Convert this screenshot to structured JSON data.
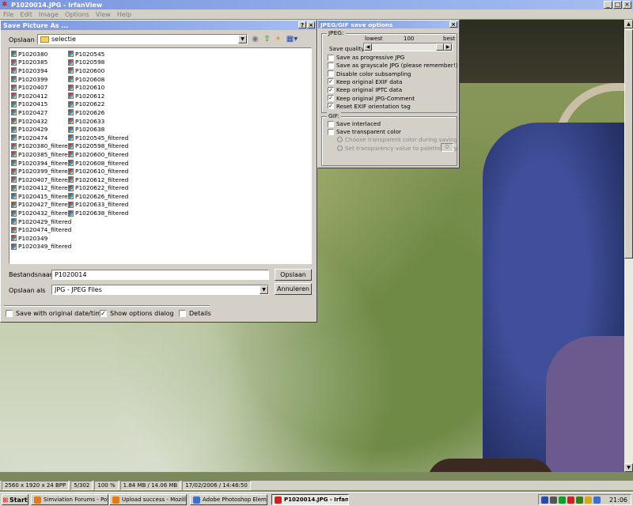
{
  "window": {
    "title": "P1020014.JPG - IrfanView",
    "menu": [
      "File",
      "Edit",
      "Image",
      "Options",
      "View",
      "Help"
    ]
  },
  "dialog": {
    "title": "Save Picture As ...",
    "look_in_label": "Opslaan in:",
    "look_in_value": "selectie",
    "files_col1": [
      "P1020380",
      "P1020385",
      "P1020394",
      "P1020399",
      "P1020407",
      "P1020412",
      "P1020415",
      "P1020427",
      "P1020432",
      "P1020429",
      "P1020474",
      "P1020380_filtered",
      "P1020385_filtered",
      "P1020394_filtered",
      "P1020399_filtered",
      "P1020407_filtered",
      "P1020412_filtered",
      "P1020415_filtered",
      "P1020427_filtered",
      "P1020432_filtered",
      "P1020429_filtered",
      "P1020474_filtered",
      "P1020349",
      "P1020349_filtered"
    ],
    "files_col2": [
      "P1020545",
      "P1020598",
      "P1020600",
      "P1020608",
      "P1020610",
      "P1020612",
      "P1020622",
      "P1020626",
      "P1020633",
      "P1020638",
      "P1020545_filtered",
      "P1020598_filtered",
      "P1020600_filtered",
      "P1020608_filtered",
      "P1020610_filtered",
      "P1020612_filtered",
      "P1020622_filtered",
      "P1020626_filtered",
      "P1020633_filtered",
      "P1020638_filtered"
    ],
    "filename_label": "Bestandsnaam:",
    "filename_value": "P1020014",
    "save_button": "Opslaan",
    "savetype_label": "Opslaan als",
    "savetype_value": "JPG - JPEG Files",
    "cancel_button": "Annuleren",
    "opt_original_date": "Save with original date/time",
    "opt_original_date_checked": false,
    "opt_show_options": "Show options dialog",
    "opt_show_options_checked": true,
    "opt_details": "Details",
    "opt_details_checked": false
  },
  "options": {
    "title": "JPEG/GIF save options",
    "jpeg_group": "JPEG:",
    "quality_label": "Save quality:",
    "quality_min_label": "lowest",
    "quality_value": "100",
    "quality_max_label": "best",
    "quality_fraction": 1.0,
    "jpeg_checks": [
      {
        "label": "Save as progressive JPG",
        "checked": false
      },
      {
        "label": "Save as grayscale JPG (please remember!)",
        "checked": false
      },
      {
        "label": "Disable color subsampling",
        "checked": false
      },
      {
        "label": "Keep original EXIF data",
        "checked": true
      },
      {
        "label": "Keep original IPTC data",
        "checked": true
      },
      {
        "label": "Keep original JPG-Comment",
        "checked": true
      },
      {
        "label": "Reset EXIF orientation tag",
        "checked": true
      }
    ],
    "gif_group": "GIF:",
    "gif_checks": [
      {
        "label": "Save interlaced",
        "checked": false
      },
      {
        "label": "Save transparent color",
        "checked": false
      }
    ],
    "gif_radio1": "Choose transparent color during saving",
    "gif_radio2": "Set transparency value to palette entry:",
    "palette_entry": "0"
  },
  "status": {
    "dimensions": "2560 x 1920 x 24 BPP",
    "index": "5/302",
    "zoom": "100 %",
    "size": "1.84 MB / 14.06 MB",
    "datetime": "17/02/2006 / 14:46:50"
  },
  "taskbar": {
    "start": "Start",
    "tasks": [
      {
        "label": "Simviation Forums - Post ...",
        "color": "#e07b1a"
      },
      {
        "label": "Upload success - Mozilla ...",
        "color": "#e07b1a"
      },
      {
        "label": "Adobe Photoshop Eleme...",
        "color": "#3c6fc5"
      },
      {
        "label": "P1020014.JPG - Irfan...",
        "color": "#c22",
        "active": true
      }
    ],
    "clock": "21:06"
  }
}
